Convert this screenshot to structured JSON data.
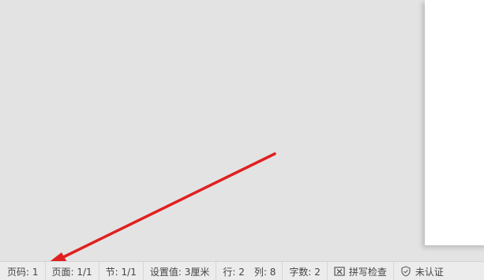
{
  "status_bar": {
    "page_code": "页码: 1",
    "page": "页面: 1/1",
    "section": "节: 1/1",
    "setting_value": "设置值: 3厘米",
    "row": "行: 2",
    "column": "列: 8",
    "word_count": "字数: 2",
    "spell_check": "拼写检查",
    "unverified": "未认证"
  },
  "icons": {
    "spell_check_icon": "spell-check-icon",
    "shield_icon": "shield-icon"
  },
  "colors": {
    "arrow": "#e02020",
    "workspace": "#e3e3e3",
    "status_bar": "#ececec"
  }
}
